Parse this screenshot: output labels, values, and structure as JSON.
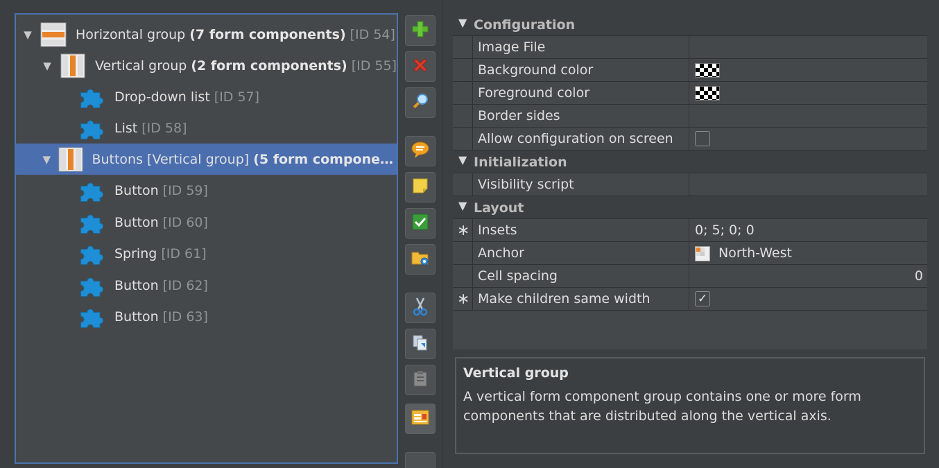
{
  "tree": {
    "nodes": [
      {
        "name": "Horizontal group",
        "count": "(7 form components)",
        "id": "[ID 54]",
        "icon": "horizontal-group-icon"
      },
      {
        "name": "Vertical group",
        "count": "(2 form components)",
        "id": "[ID 55]",
        "icon": "vertical-group-icon"
      },
      {
        "name": "Drop-down list",
        "id": "[ID 57]",
        "icon": "puzzle-piece-icon"
      },
      {
        "name": "List",
        "id": "[ID 58]",
        "icon": "puzzle-piece-icon"
      },
      {
        "name": "Buttons [Vertical group]",
        "count": "(5 form component…",
        "icon": "vertical-group-icon",
        "selected": true
      },
      {
        "name": "Button",
        "id": "[ID 59]",
        "icon": "puzzle-piece-icon"
      },
      {
        "name": "Button",
        "id": "[ID 60]",
        "icon": "puzzle-piece-icon"
      },
      {
        "name": "Spring",
        "id": "[ID 61]",
        "icon": "puzzle-piece-icon"
      },
      {
        "name": "Button",
        "id": "[ID 62]",
        "icon": "puzzle-piece-icon"
      },
      {
        "name": "Button",
        "id": "[ID 63]",
        "icon": "puzzle-piece-icon"
      }
    ]
  },
  "toolbar": {
    "buttons": [
      "add-icon",
      "delete-icon",
      "search-icon",
      "comment-icon",
      "note-icon",
      "check-icon",
      "folder-settings-icon",
      "cut-icon",
      "copy-icon",
      "paste-icon",
      "form-layout-icon"
    ]
  },
  "properties": {
    "configuration": {
      "title": "Configuration",
      "image_file": "Image File",
      "background_color": "Background color",
      "foreground_color": "Foreground color",
      "border_sides": "Border sides",
      "allow_config": "Allow configuration on screen",
      "allow_config_checked": false
    },
    "initialization": {
      "title": "Initialization",
      "visibility_script": "Visibility script"
    },
    "layout": {
      "title": "Layout",
      "insets_label": "Insets",
      "insets_value": "0; 5; 0; 0",
      "anchor_label": "Anchor",
      "anchor_value": "North-West",
      "cell_spacing_label": "Cell spacing",
      "cell_spacing_value": "0",
      "same_width_label": "Make children same width",
      "same_width_checked": true,
      "modified_marker": "∗"
    }
  },
  "description": {
    "title": "Vertical group",
    "text": "A vertical form component group contains one or more form components that are distributed along the vertical axis."
  },
  "colors": {
    "background": "#3c3f41",
    "selection": "#4b6eaf",
    "panel_border": "#4a72b0",
    "puzzle_blue": "#1e8fd6"
  }
}
